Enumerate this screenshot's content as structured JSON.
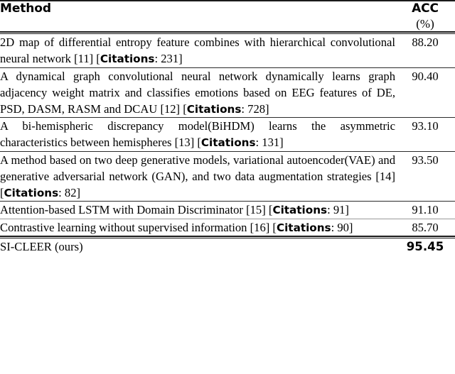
{
  "table": {
    "columns": [
      {
        "key": "method",
        "label": "Method"
      },
      {
        "key": "acc",
        "label": "ACC",
        "unit": "(%)"
      }
    ],
    "rows": [
      {
        "method_pre": "2D map of differential entropy feature combines with hierarchical convolutional neural network [11] [",
        "citations_label": "Citations",
        "method_post": ": 231]",
        "acc": "88.20"
      },
      {
        "method_pre": "A dynamical graph convolutional neural network dynamically learns graph adjacency weight matrix and classifies emotions based on EEG features of DE, PSD, DASM, RASM and DCAU [12] [",
        "citations_label": "Citations",
        "method_post": ": 728]",
        "acc": "90.40"
      },
      {
        "method_pre": "A bi-hemispheric discrepancy model(BiHDM) learns the asymmetric characteristics between hemispheres [13] [",
        "citations_label": "Citations",
        "method_post": ": 131]",
        "acc": "93.10"
      },
      {
        "method_pre": "A method based on two deep generative models, variational autoencoder(VAE) and generative adversarial network (GAN), and two data augmentation strategies [14] [",
        "citations_label": "Citations",
        "method_post": ": 82]",
        "acc": "93.50"
      },
      {
        "method_pre": "Attention-based LSTM with Domain Discriminator [15] [",
        "citations_label": "Citations",
        "method_post": ": 91]",
        "acc": "91.10"
      },
      {
        "method_pre": "Contrastive learning without supervised information [16] [",
        "citations_label": "Citations",
        "method_post": ": 90]",
        "acc": "85.70"
      }
    ],
    "final_row": {
      "method": "SI-CLEER (ours)",
      "acc": "95.45"
    }
  },
  "colors": {
    "text": "#000000",
    "rule_dark": "#1a1a1a",
    "rule_light": "#9a9a9a",
    "background": "#ffffff"
  }
}
